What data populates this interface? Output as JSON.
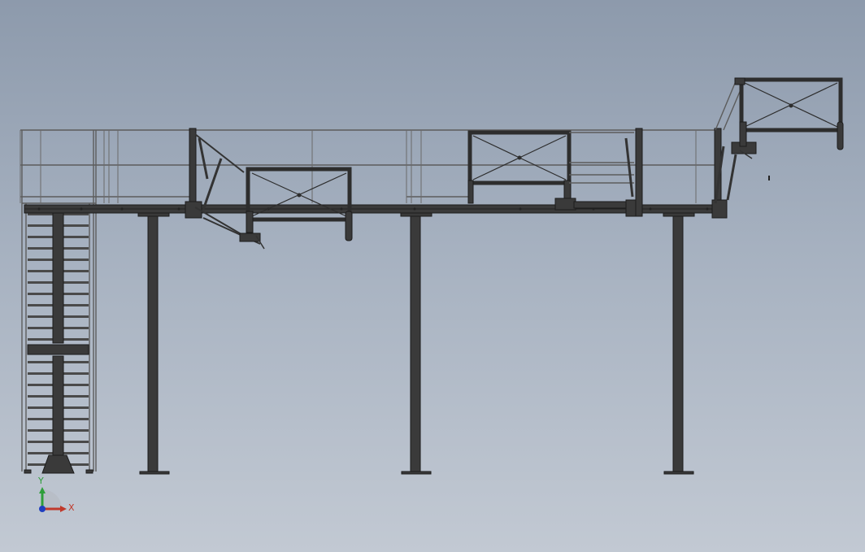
{
  "viewport": {
    "background_top": "#8d9aac",
    "background_bottom": "#c2c9d3",
    "model_color": "#3a3a3a"
  },
  "triad": {
    "x_label": "X",
    "y_label": "Y",
    "x_color": "#c0392b",
    "y_color": "#2e9e3a",
    "z_color": "#1f3fbf"
  }
}
